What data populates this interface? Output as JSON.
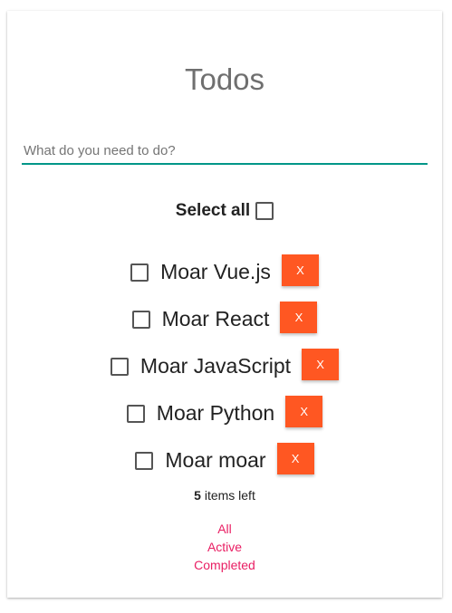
{
  "header": {
    "title": "Todos"
  },
  "new_todo": {
    "value": "",
    "placeholder": "What do you need to do?"
  },
  "select_all": {
    "label": "Select all",
    "checked": false
  },
  "todos": [
    {
      "label": "Moar Vue.js",
      "completed": false,
      "delete_label": "X"
    },
    {
      "label": "Moar React",
      "completed": false,
      "delete_label": "X"
    },
    {
      "label": "Moar JavaScript",
      "completed": false,
      "delete_label": "X"
    },
    {
      "label": "Moar Python",
      "completed": false,
      "delete_label": "X"
    },
    {
      "label": "Moar moar",
      "completed": false,
      "delete_label": "X"
    }
  ],
  "footer": {
    "items_left_count": "5",
    "items_left_suffix": " items left",
    "filters": [
      "All",
      "Active",
      "Completed"
    ]
  },
  "colors": {
    "accent": "#009688",
    "delete_button": "#ff5722",
    "filter_link": "#e91e63"
  }
}
